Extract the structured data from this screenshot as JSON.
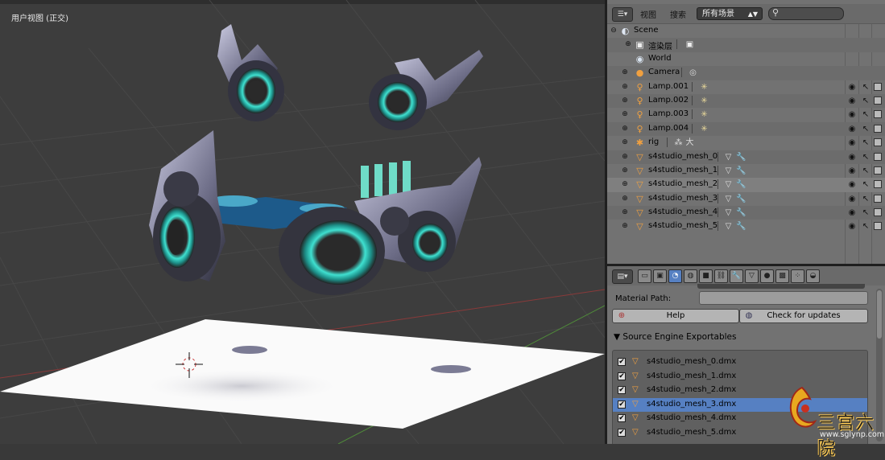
{
  "viewport": {
    "title": "用户视图 (正交)"
  },
  "outliner": {
    "editor_icon": "outliner-icon",
    "menu": [
      "视图",
      "搜索"
    ],
    "scene_select": "所有场景",
    "search_placeholder": "",
    "rows": [
      {
        "label": "Scene",
        "icon": "scene-icon",
        "indent": 0
      },
      {
        "label": "渲染层",
        "icon": "render-layers-icon",
        "indent": 1
      },
      {
        "label": "World",
        "icon": "world-icon",
        "indent": 1
      },
      {
        "label": "Camera",
        "icon": "camera-icon",
        "indent": 1
      },
      {
        "label": "Lamp.001",
        "icon": "lamp-icon",
        "indent": 1
      },
      {
        "label": "Lamp.002",
        "icon": "lamp-icon",
        "indent": 1
      },
      {
        "label": "Lamp.003",
        "icon": "lamp-icon",
        "indent": 1
      },
      {
        "label": "Lamp.004",
        "icon": "lamp-icon",
        "indent": 1
      },
      {
        "label": "rig",
        "icon": "armature-icon",
        "indent": 1
      },
      {
        "label": "s4studio_mesh_0",
        "icon": "mesh-icon",
        "indent": 1
      },
      {
        "label": "s4studio_mesh_1",
        "icon": "mesh-icon",
        "indent": 1
      },
      {
        "label": "s4studio_mesh_2",
        "icon": "mesh-icon",
        "indent": 1
      },
      {
        "label": "s4studio_mesh_3",
        "icon": "mesh-icon",
        "indent": 1
      },
      {
        "label": "s4studio_mesh_4",
        "icon": "mesh-icon",
        "indent": 1
      },
      {
        "label": "s4studio_mesh_5",
        "icon": "mesh-icon",
        "indent": 1
      }
    ]
  },
  "properties": {
    "material_path_label": "Material Path:",
    "material_path_value": "",
    "help_label": "Help",
    "updates_label": "Check for updates",
    "panel_title": "▼ Source Engine Exportables",
    "exportables": [
      {
        "label": "s4studio_mesh_0.dmx",
        "checked": true
      },
      {
        "label": "s4studio_mesh_1.dmx",
        "checked": true
      },
      {
        "label": "s4studio_mesh_2.dmx",
        "checked": true
      },
      {
        "label": "s4studio_mesh_3.dmx",
        "checked": true,
        "selected": true
      },
      {
        "label": "s4studio_mesh_4.dmx",
        "checked": true
      },
      {
        "label": "s4studio_mesh_5.dmx",
        "checked": true
      }
    ]
  },
  "watermark": {
    "text": "三宫六院",
    "url": "www.sglynp.com"
  },
  "colors": {
    "selection_blue": "#5680c2",
    "viewport_bg": "#3d3d3d",
    "panel_bg": "#727272",
    "mesh_icon_orange": "#f0a040",
    "glow_cyan": "#3fe0d0"
  }
}
